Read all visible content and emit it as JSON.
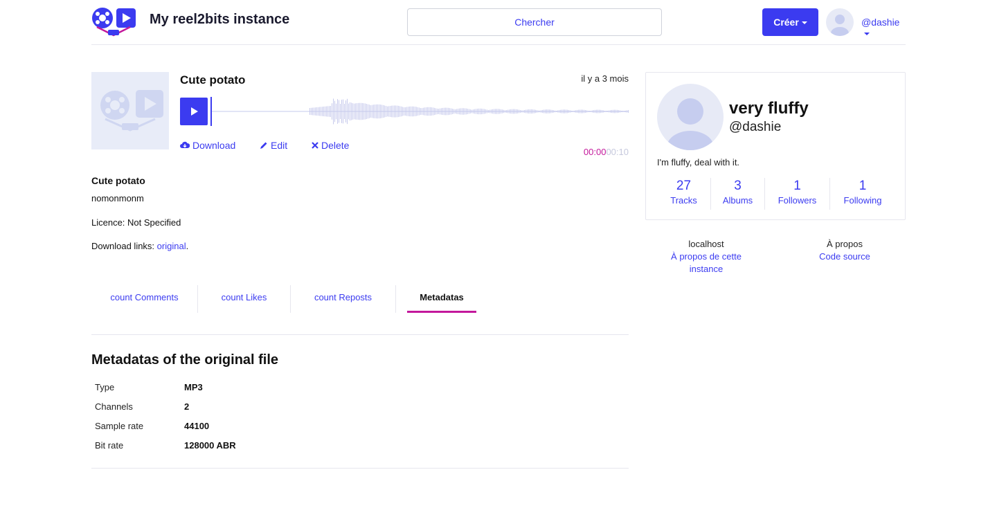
{
  "header": {
    "site_title": "My reel2bits instance",
    "search_placeholder": "Chercher",
    "create_label": "Créer",
    "username": "@dashie"
  },
  "track": {
    "title": "Cute potato",
    "posted": "il y a 3 mois",
    "actions": {
      "download": "Download",
      "edit": "Edit",
      "delete": "Delete"
    },
    "current_time": "00:00",
    "total_time": "00:10",
    "description_title": "Cute potato",
    "description": "nomonmonm",
    "licence": "Licence: Not Specified",
    "download_links_label": "Download links:",
    "download_link": "original",
    "download_links_end": "."
  },
  "tabs": [
    {
      "label": "count Comments"
    },
    {
      "label": "count Likes"
    },
    {
      "label": "count Reposts"
    },
    {
      "label": "Metadatas",
      "active": true
    }
  ],
  "metadata": {
    "title": "Metadatas of the original file",
    "rows": [
      {
        "key": "Type",
        "value": "MP3"
      },
      {
        "key": "Channels",
        "value": "2"
      },
      {
        "key": "Sample rate",
        "value": "44100"
      },
      {
        "key": "Bit rate",
        "value": "128000 ABR"
      }
    ]
  },
  "profile": {
    "name": "very fluffy",
    "handle": "@dashie",
    "bio": "I'm fluffy, deal with it.",
    "stats": [
      {
        "value": "27",
        "label": "Tracks"
      },
      {
        "value": "3",
        "label": "Albums"
      },
      {
        "value": "1",
        "label": "Followers"
      },
      {
        "value": "1",
        "label": "Following"
      }
    ]
  },
  "footer": {
    "left_heading": "localhost",
    "left_link": "À propos de cette instance",
    "right_heading": "À propos",
    "right_link": "Code source"
  },
  "colors": {
    "accent": "#3b3bf0",
    "highlight": "#c3189b",
    "placeholder": "#e8ecf8"
  }
}
